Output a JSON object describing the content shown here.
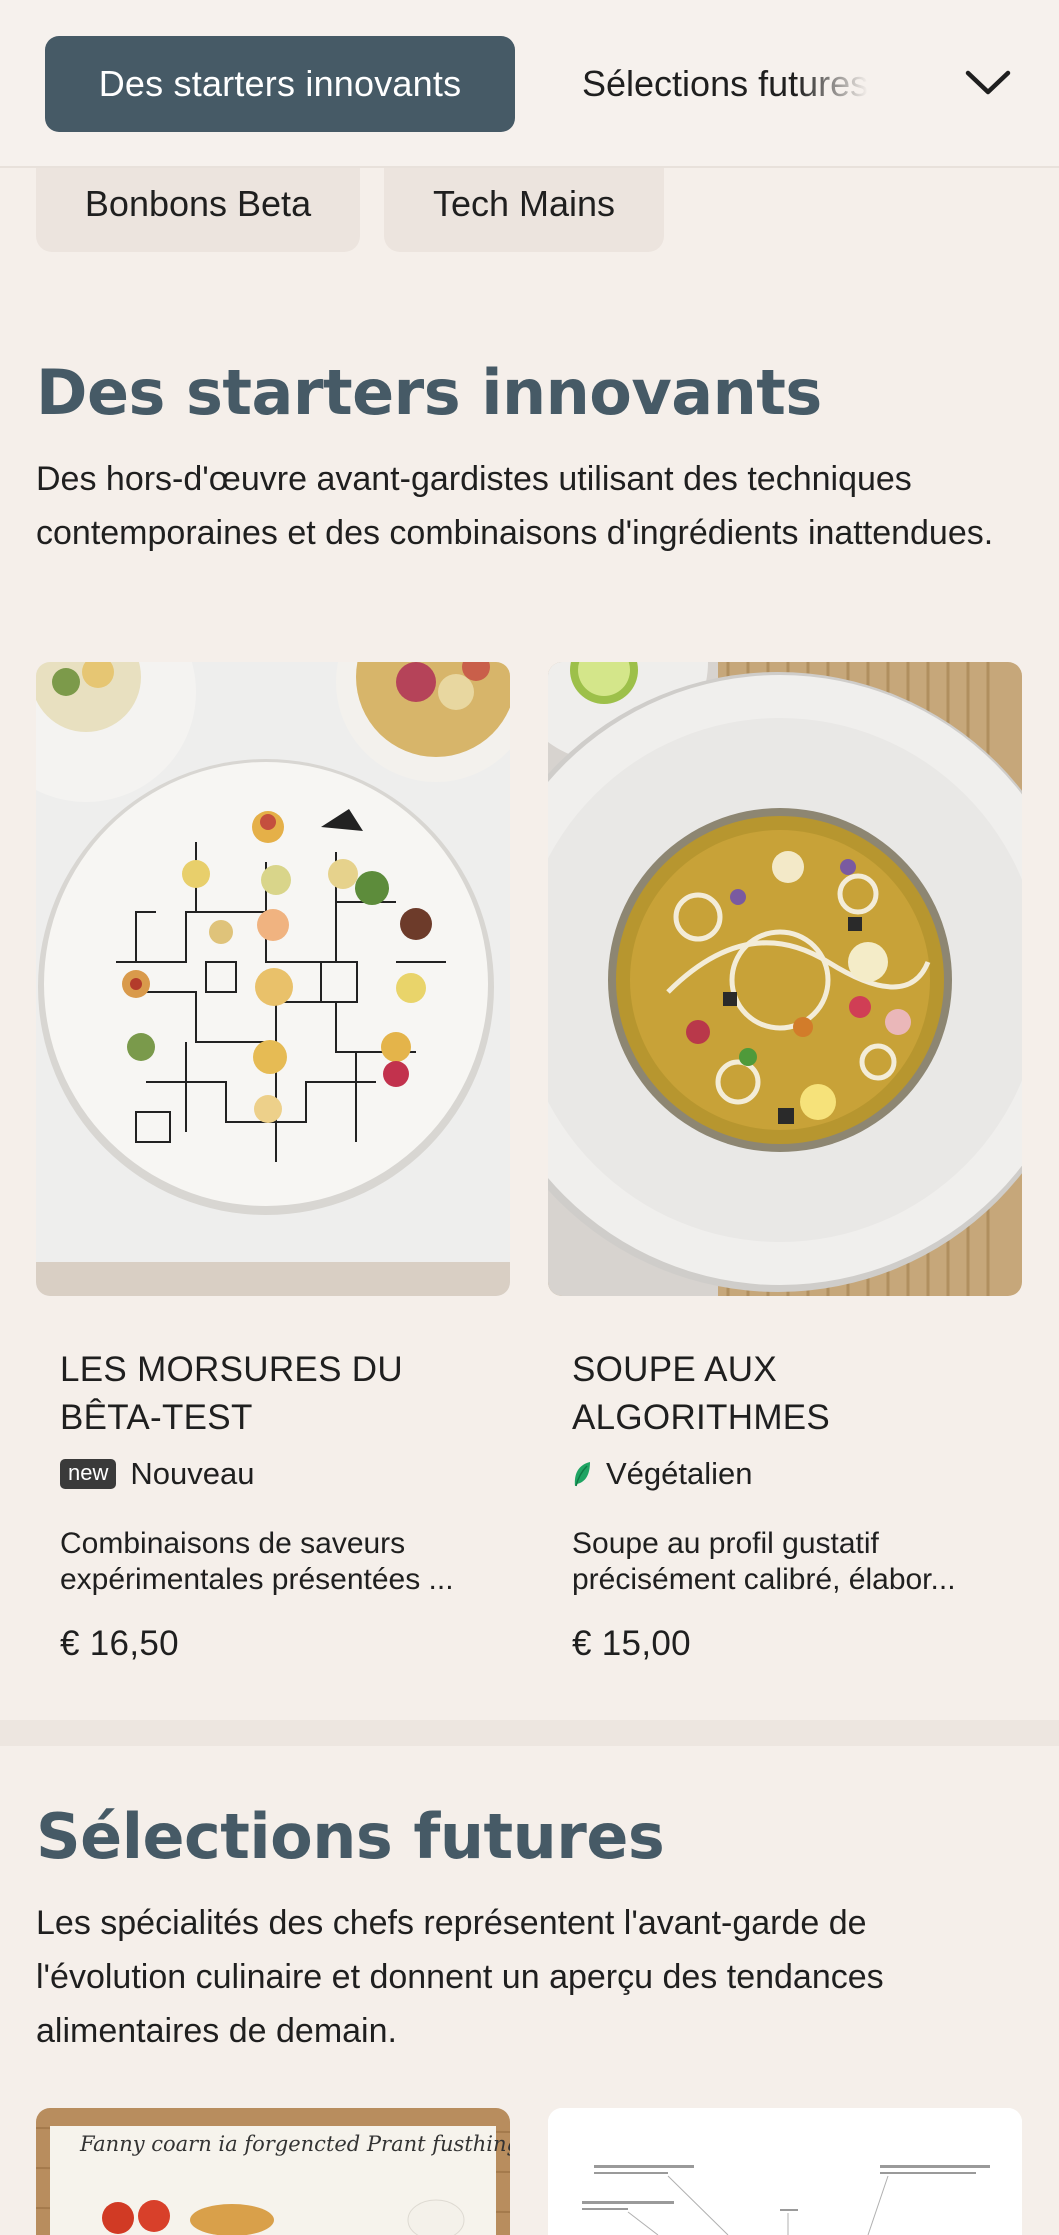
{
  "category_bar": {
    "active": "Des starters innovants",
    "next": "Sélections futures",
    "toggle_icon": "chevron-down-icon"
  },
  "chips": [
    "Bonbons Beta",
    "Tech Mains"
  ],
  "sections": [
    {
      "title": "Des starters innovants",
      "description": "Des hors-d'œuvre avant-gardistes utilisant des techniques contemporaines et des combinaisons d'ingrédients inattendues.",
      "items": [
        {
          "name_line1": "LES MORSURES DU",
          "name_line2": "BÊTA-TEST",
          "badge": "new",
          "tag": "Nouveau",
          "desc_line1": "Combinaisons de saveurs",
          "desc_line2": "expérimentales présentées ...",
          "price": "€ 16,50"
        },
        {
          "name_line1": "SOUPE AUX",
          "name_line2": "ALGORITHMES",
          "tag_icon": "leaf-icon",
          "tag": "Végétalien",
          "desc_line1": "Soupe au profil gustatif",
          "desc_line2": "précisément calibré, élabor...",
          "price": "€ 15,00"
        }
      ]
    },
    {
      "title": "Sélections futures",
      "description": "Les spécialités des chefs représentent l'avant-garde de l'évolution culinaire et donnent un aperçu des tendances alimentaires de demain.",
      "preview_text": "Fanny coarn ia forgencted Prant fusthing"
    }
  ],
  "colors": {
    "accent": "#465a66",
    "background": "#f5efea",
    "vegan": "#1fa463"
  }
}
